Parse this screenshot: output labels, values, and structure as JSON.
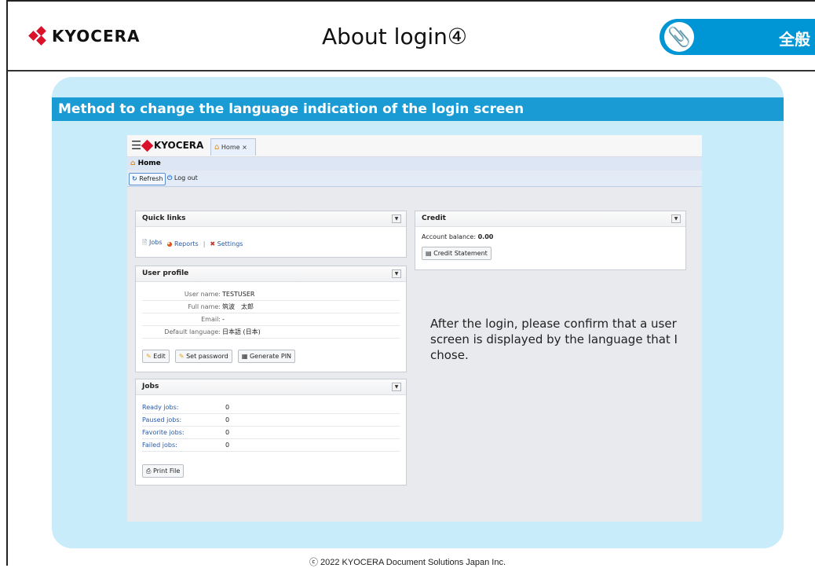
{
  "header": {
    "logo_text": "KYOCERA",
    "title": "About login④",
    "tag_label": "全般"
  },
  "section": {
    "heading": "Method to change the language indication of the login screen"
  },
  "app": {
    "logo_text": "KYOCERA",
    "tab_label": "Home",
    "tab_close": "×",
    "breadcrumb": "Home",
    "toolbar": {
      "refresh_label": "Refresh",
      "logout_label": "Log out"
    },
    "quick_links": {
      "title": "Quick links",
      "items": [
        {
          "label": "Jobs"
        },
        {
          "label": "Reports"
        },
        {
          "label": "Settings"
        }
      ]
    },
    "user_profile": {
      "title": "User profile",
      "fields": [
        {
          "key": "User name:",
          "value": "TESTUSER"
        },
        {
          "key": "Full name:",
          "value": "筑波　太郎"
        },
        {
          "key": "Email:",
          "value": "-"
        },
        {
          "key": "Default language:",
          "value": "日本語 (日本)"
        }
      ],
      "buttons": {
        "edit": "Edit",
        "set_password": "Set password",
        "generate_pin": "Generate PIN"
      }
    },
    "jobs": {
      "title": "Jobs",
      "rows": [
        {
          "label": "Ready jobs:",
          "value": "0"
        },
        {
          "label": "Paused jobs:",
          "value": "0"
        },
        {
          "label": "Favorite jobs:",
          "value": "0"
        },
        {
          "label": "Failed jobs:",
          "value": "0"
        }
      ],
      "print_button": "Print File"
    },
    "credit": {
      "title": "Credit",
      "balance_label": "Account balance:",
      "balance_value": "0.00",
      "statement_button": "Credit Statement"
    }
  },
  "note": "After the login, please confirm that a user screen is displayed by the language that I chose.",
  "footer": "ⓒ 2022 KYOCERA Document Solutions Japan Inc.",
  "colors": {
    "accent": "#0096d6",
    "panel_bg": "#c9ecfa",
    "brand_red": "#d9122a"
  }
}
